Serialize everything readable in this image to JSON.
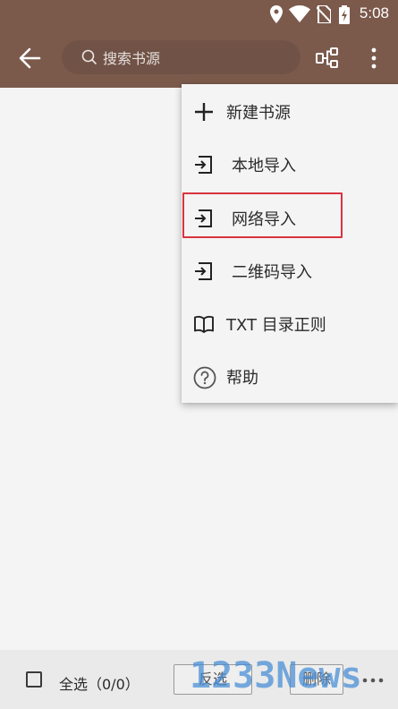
{
  "status_bar": {
    "time": "5:08",
    "icons": [
      "location-icon",
      "wifi-icon",
      "no-sim-icon",
      "battery-charging-icon"
    ]
  },
  "app_bar": {
    "back_icon": "arrow-left-icon",
    "search": {
      "placeholder": "搜索书源",
      "value": ""
    },
    "group_icon": "group-tree-icon",
    "more_icon": "more-vert-icon"
  },
  "menu": {
    "items": [
      {
        "label": "新建书源",
        "icon": "plus-icon"
      },
      {
        "label": "本地导入",
        "icon": "import-icon"
      },
      {
        "label": "网络导入",
        "icon": "import-icon",
        "highlighted": true
      },
      {
        "label": "二维码导入",
        "icon": "import-icon"
      },
      {
        "label": "TXT 目录正则",
        "icon": "book-open-icon"
      },
      {
        "label": "帮助",
        "icon": "help-icon"
      }
    ]
  },
  "bottom_bar": {
    "select_all_label": "全选（0/0）",
    "select_all_checked": false,
    "invert_label": "反选",
    "delete_label": "删除",
    "more_icon": "more-horiz-icon"
  },
  "watermark": {
    "text": "1233News"
  },
  "colors": {
    "header": "#7b5a4c",
    "background": "#f4f4f4",
    "highlight_border": "#d9343f",
    "watermark": "#448cd6"
  }
}
